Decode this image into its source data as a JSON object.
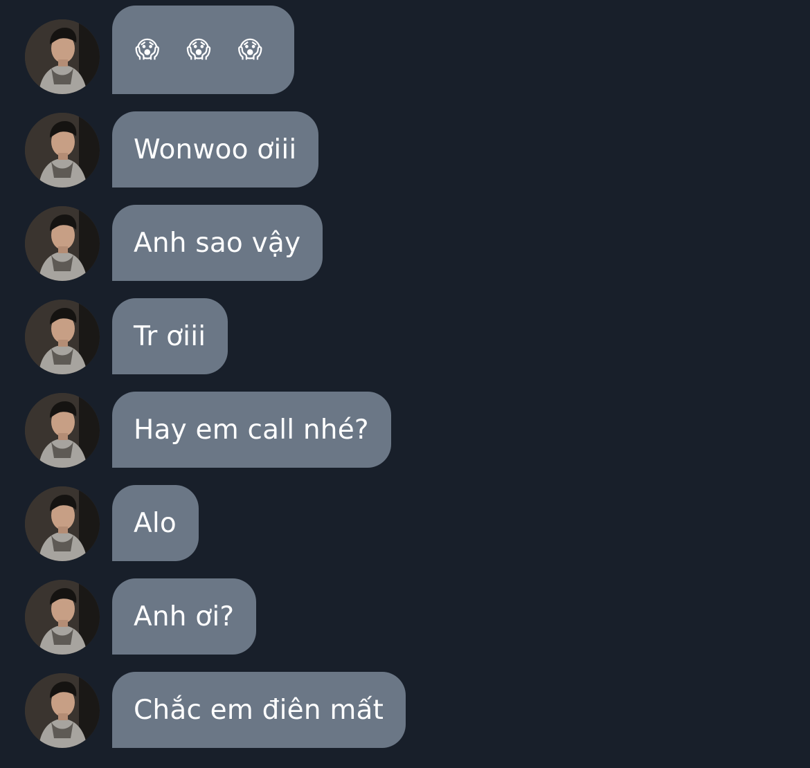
{
  "messages": [
    {
      "text": "😱 😱 😱",
      "kind": "emoji"
    },
    {
      "text": "Wonwoo ơiii",
      "kind": "text"
    },
    {
      "text": "Anh sao vậy",
      "kind": "text"
    },
    {
      "text": "Tr ơiii",
      "kind": "text"
    },
    {
      "text": "Hay em call nhé?",
      "kind": "text"
    },
    {
      "text": "Alo",
      "kind": "text"
    },
    {
      "text": "Anh ơi?",
      "kind": "text"
    },
    {
      "text": "Chắc em điên mất",
      "kind": "text"
    }
  ],
  "colors": {
    "background": "#181f2a",
    "bubble": "#6b7786",
    "text": "#ffffff"
  },
  "icons": {
    "emoji": "face-screaming-in-fear-icon",
    "avatar": "profile-photo"
  }
}
